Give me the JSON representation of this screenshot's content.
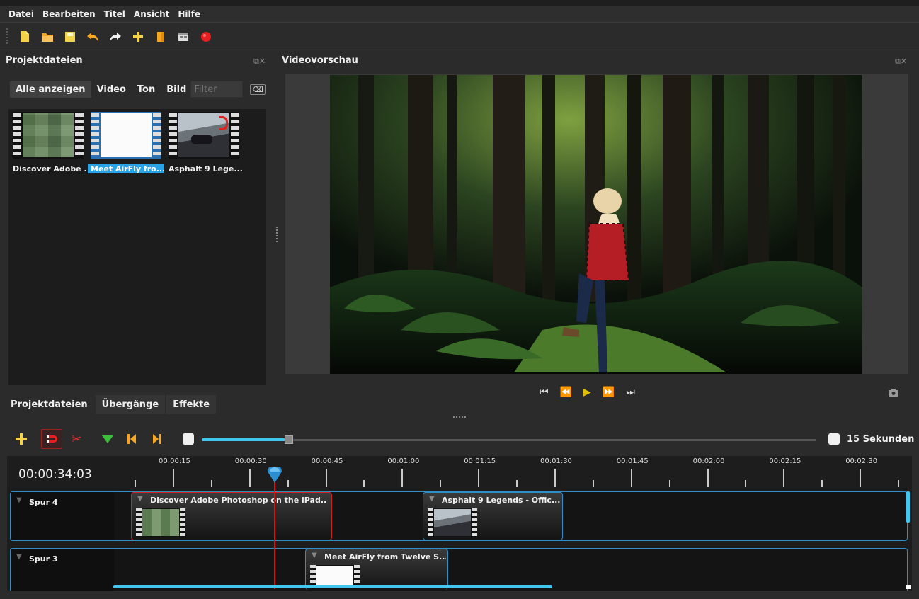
{
  "menu": {
    "items": [
      "Datei",
      "Bearbeiten",
      "Titel",
      "Ansicht",
      "Hilfe"
    ]
  },
  "toolbar": {
    "icons": [
      "new-project-icon",
      "open-project-icon",
      "save-project-icon",
      "undo-icon",
      "redo-icon",
      "import-files-icon",
      "profile-icon",
      "fullscreen-icon",
      "export-video-icon"
    ]
  },
  "project_files": {
    "title": "Projektdateien",
    "filters": {
      "all": "Alle anzeigen",
      "video": "Video",
      "audio": "Ton",
      "image": "Bild",
      "search_placeholder": "Filter"
    },
    "files": [
      {
        "label": "Discover Adobe ...",
        "selected": false
      },
      {
        "label": "Meet AirFly fro...",
        "selected": true
      },
      {
        "label": "Asphalt 9 Lege...",
        "selected": false
      }
    ]
  },
  "preview": {
    "title": "Videovorschau"
  },
  "bottom_tabs": {
    "files": "Projektdateien",
    "transitions": "Übergänge",
    "effects": "Effekte"
  },
  "timeline": {
    "zoom_label": "15 Sekunden",
    "timecode": "00:00:34:03",
    "ruler_labels": [
      "00:00:15",
      "00:00:30",
      "00:00:45",
      "00:01:00",
      "00:01:15",
      "00:01:30",
      "00:01:45",
      "00:02:00",
      "00:02:15",
      "00:02:30"
    ],
    "tracks": [
      {
        "name": "Spur 4",
        "clips": [
          {
            "title": "Discover Adobe Photoshop on the iPad...."
          },
          {
            "title": "Asphalt 9 Legends - Offic..."
          }
        ]
      },
      {
        "name": "Spur 3",
        "clips": [
          {
            "title": "Meet AirFly from Twelve S..."
          }
        ]
      }
    ]
  },
  "colors": {
    "accent": "#3ec8f0",
    "selection": "#2aa3e6",
    "playhead": "#e01010"
  }
}
